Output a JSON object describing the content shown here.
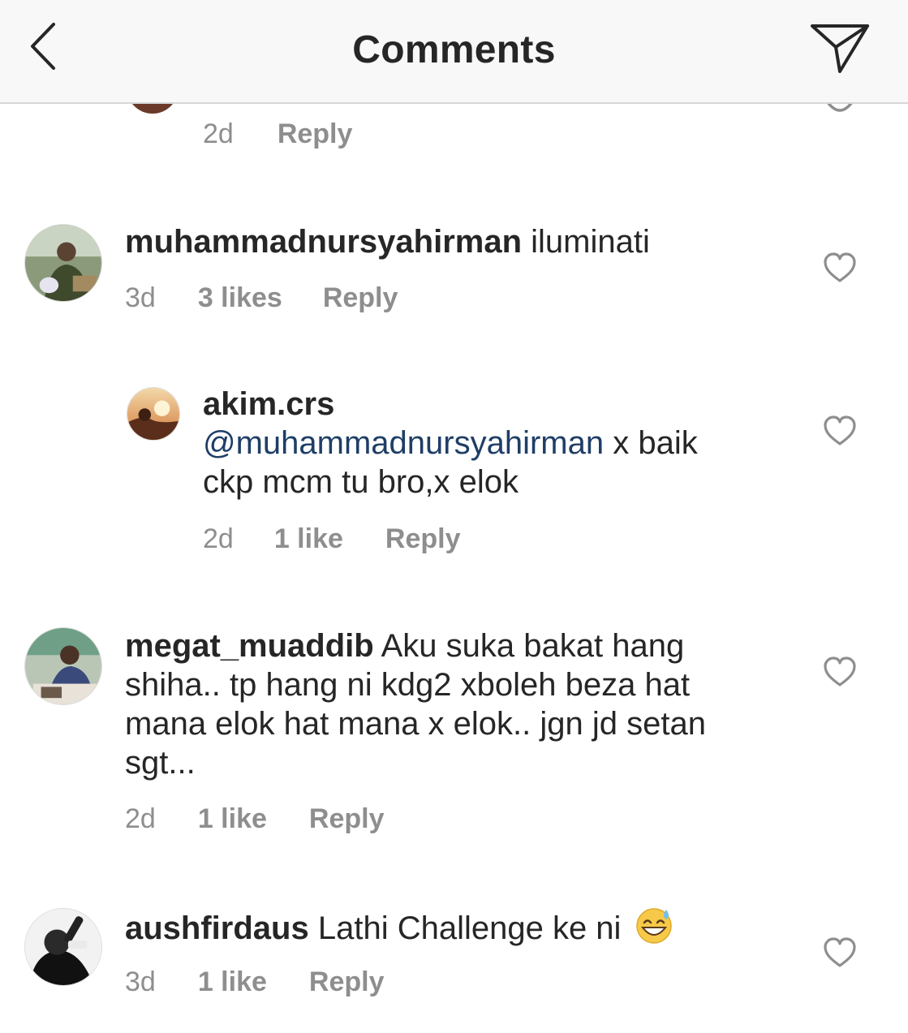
{
  "header": {
    "title": "Comments",
    "back_icon": "chevron-left-icon",
    "share_icon": "paper-plane-icon"
  },
  "reply_label": "Reply",
  "partial_comment": {
    "time": "2d",
    "reply": "Reply"
  },
  "comments": [
    {
      "username": "muhammadnursyahirman",
      "text": "iluminati",
      "time": "3d",
      "likes": "3 likes",
      "reply": "Reply"
    },
    {
      "username": "akim.crs",
      "mention": "@muhammadnursyahirman",
      "text_line1": "x baik",
      "text_line2": "ckp mcm tu bro,x elok",
      "time": "2d",
      "likes": "1 like",
      "reply": "Reply"
    },
    {
      "username": "megat_muaddib",
      "text_line1": "Aku suka bakat hang",
      "text_line2": "shiha.. tp hang ni kdg2 xboleh beza hat",
      "text_line3": "mana elok hat mana x elok.. jgn jd setan",
      "text_line4": "sgt...",
      "time": "2d",
      "likes": "1 like",
      "reply": "Reply"
    },
    {
      "username": "aushfirdaus",
      "text": "Lathi Challenge ke ni",
      "emoji": "grinning-sweat-emoji",
      "time": "3d",
      "likes": "1 like",
      "reply": "Reply"
    }
  ],
  "colors": {
    "text": "#262626",
    "meta": "#8e8e8e",
    "mention": "#1f3e67",
    "header_bg": "#f8f8f8"
  }
}
